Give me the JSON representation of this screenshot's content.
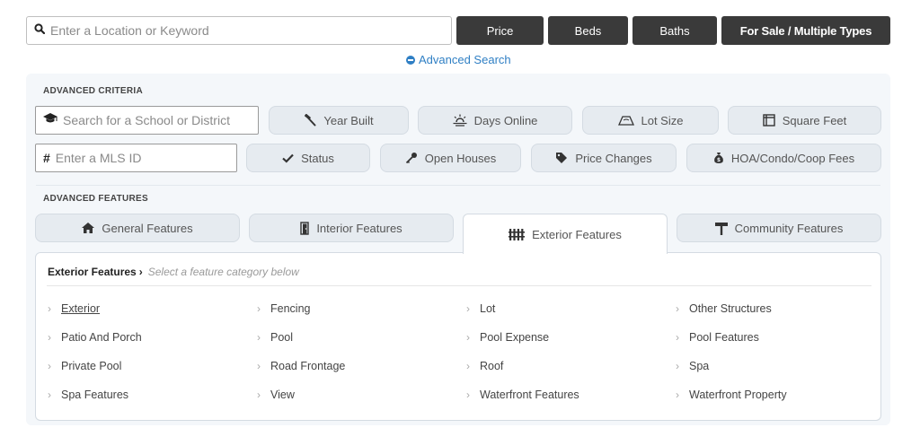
{
  "search": {
    "placeholder": "Enter a Location or Keyword",
    "icon": "search-icon"
  },
  "filters": {
    "price": "Price",
    "beds": "Beds",
    "baths": "Baths",
    "type": "For Sale / Multiple Types"
  },
  "advanced_link": "Advanced Search",
  "advanced_criteria": {
    "label": "ADVANCED CRITERIA",
    "school_placeholder": "Search for a School or District",
    "mls_placeholder": "Enter a MLS ID",
    "year_built": "Year Built",
    "days_online": "Days Online",
    "lot_size": "Lot Size",
    "square_feet": "Square Feet",
    "status": "Status",
    "open_houses": "Open Houses",
    "price_changes": "Price Changes",
    "hoa_fees": "HOA/Condo/Coop Fees"
  },
  "advanced_features": {
    "label": "ADVANCED FEATURES",
    "tabs": [
      "General Features",
      "Interior Features",
      "Exterior Features",
      "Community Features"
    ],
    "active_tab": "Exterior Features"
  },
  "exterior_panel": {
    "title": "Exterior Features",
    "hint": "Select a feature category below",
    "items": [
      "Exterior",
      "Fencing",
      "Lot",
      "Other Structures",
      "Patio And Porch",
      "Pool",
      "Pool Expense",
      "Pool Features",
      "Private Pool",
      "Road Frontage",
      "Roof",
      "Spa",
      "Spa Features",
      "View",
      "Waterfront Features",
      "Waterfront Property"
    ]
  },
  "colors": {
    "dark_button": "#3a3a3a",
    "link": "#2f7fc4",
    "panel_bg": "#f4f7fa",
    "pill_bg": "#e6ebf0"
  }
}
